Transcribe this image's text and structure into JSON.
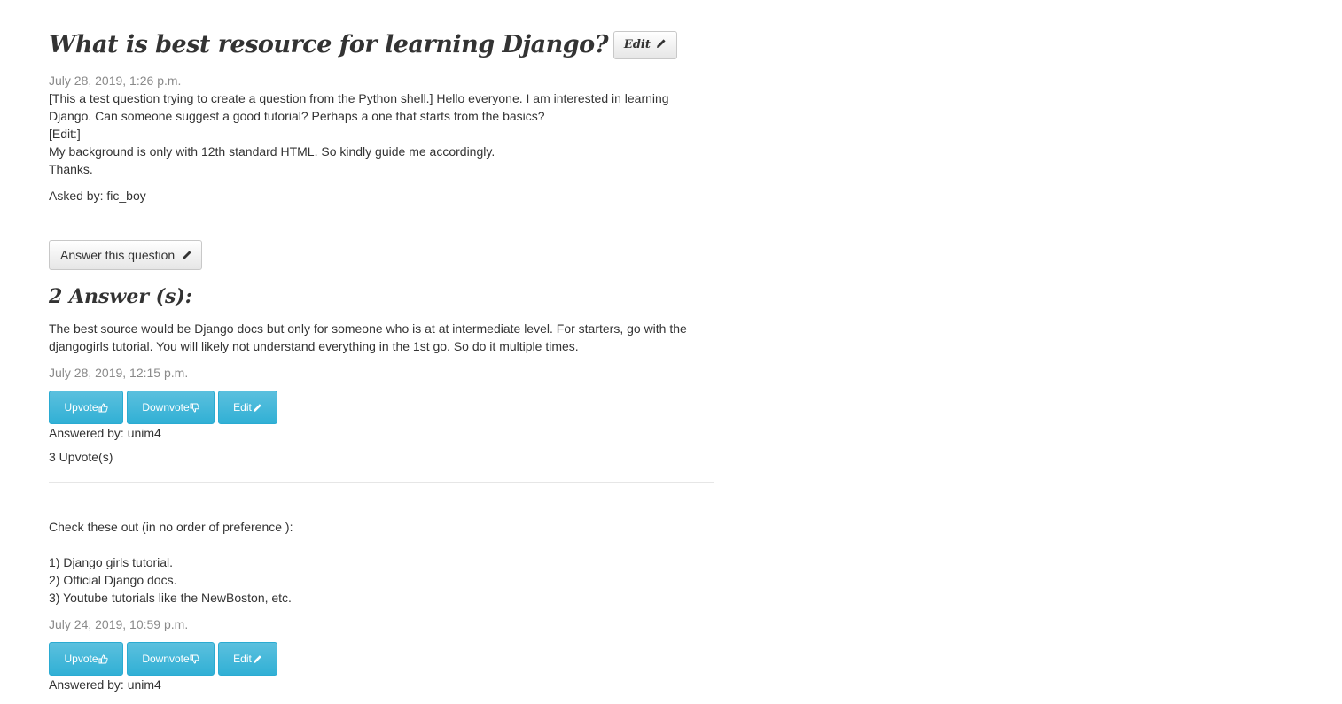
{
  "question": {
    "title": "What is best resource for learning Django?",
    "edit_label": "Edit",
    "date": "July 28, 2019, 1:26 p.m.",
    "body_lines": [
      "[This a test question trying to create a question from the Python shell.] Hello everyone. I am interested in learning",
      "Django. Can someone suggest a good tutorial? Perhaps a one that starts from the basics?",
      "[Edit:]",
      "My background is only with 12th standard HTML. So kindly guide me accordingly.",
      "Thanks."
    ],
    "asked_by": "Asked by: fic_boy"
  },
  "answer_button_label": "Answer this question",
  "answers_heading": "2 Answer (s):",
  "answers": [
    {
      "body_lines": [
        "The best source would be Django docs but only for someone who is at at intermediate level. For starters, go with the",
        "djangogirls tutorial. You will likely not understand everything in the 1st go. So do it multiple times."
      ],
      "date": "July 28, 2019, 12:15 p.m.",
      "upvote_label": "Upvote",
      "downvote_label": "Downvote",
      "edit_label": "Edit",
      "answered_by": "Answered by: unim4",
      "upvotes": "3 Upvote(s)"
    },
    {
      "body_lines": [
        "Check these out (in no order of preference ):",
        "",
        "1) Django girls tutorial.",
        "2) Official Django docs.",
        "3) Youtube tutorials like the NewBoston, etc."
      ],
      "date": "July 24, 2019, 10:59 p.m.",
      "upvote_label": "Upvote",
      "downvote_label": "Downvote",
      "edit_label": "Edit",
      "answered_by": "Answered by: unim4"
    }
  ]
}
